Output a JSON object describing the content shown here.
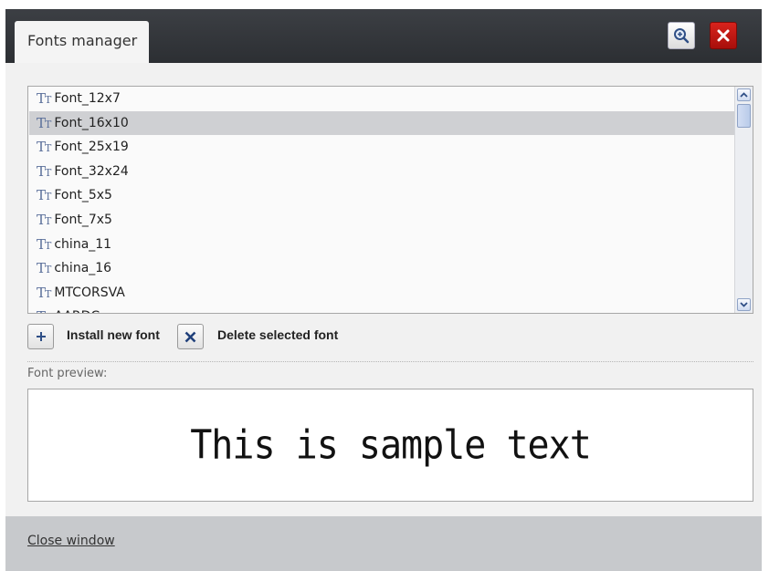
{
  "window": {
    "tab_title": "Fonts manager",
    "buttons": {
      "zoom_icon": "zoom-in-icon",
      "close_icon": "close-icon"
    },
    "colors": {
      "titlebar": "#34373b",
      "close_button": "#c11a14",
      "selection": "#cfd0d3",
      "footer": "#c7c9cc"
    }
  },
  "font_list": {
    "items": [
      {
        "label": "Font_12x7"
      },
      {
        "label": "Font_16x10"
      },
      {
        "label": "Font_25x19"
      },
      {
        "label": "Font_32x24"
      },
      {
        "label": "Font_5x5"
      },
      {
        "label": "Font_7x5"
      },
      {
        "label": "china_11"
      },
      {
        "label": "china_16"
      },
      {
        "label": "MTCORSVA"
      },
      {
        "label": "AARDC"
      }
    ],
    "selected": "Font_16x10",
    "item_icon": "font-type-icon",
    "item_icon_text": "TT"
  },
  "actions": {
    "install_label": "Install new font",
    "delete_label": "Delete selected font"
  },
  "preview": {
    "label": "Font preview:",
    "sample_text": "This is sample text"
  },
  "footer": {
    "close_label": "Close window"
  }
}
